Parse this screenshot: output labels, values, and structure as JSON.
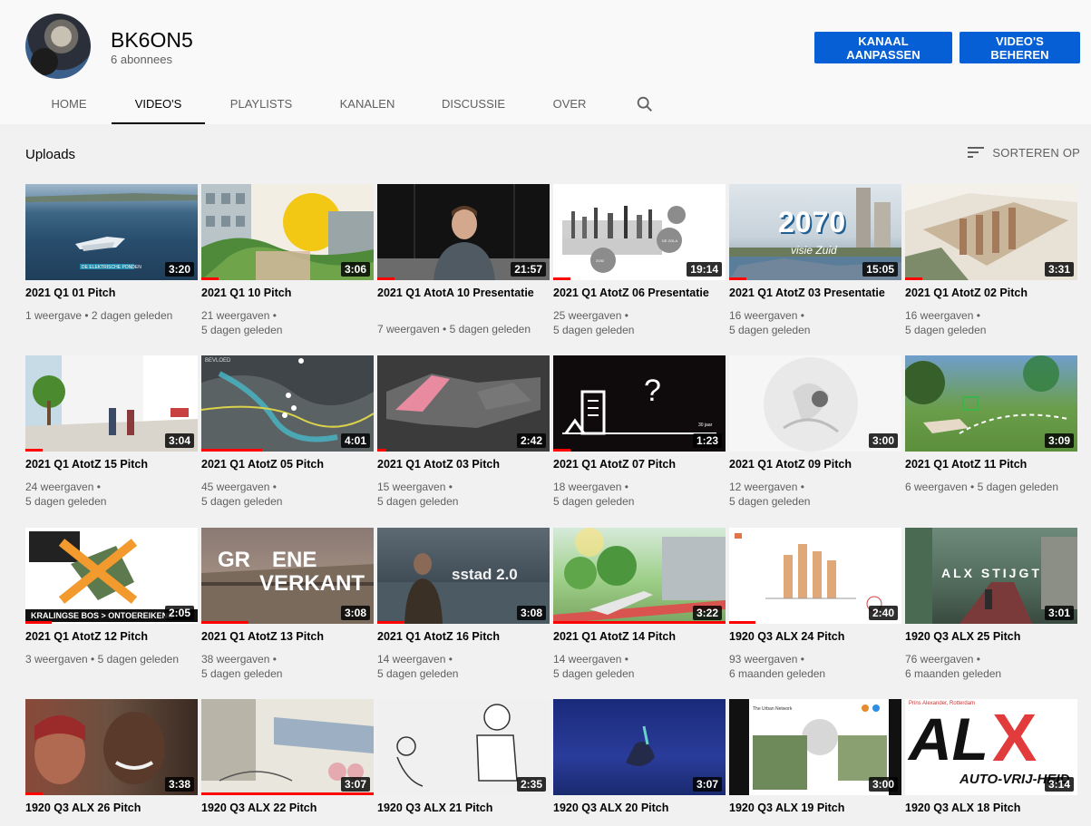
{
  "channel": {
    "name": "BK6ON5",
    "subscribers": "6 abonnees",
    "customize_label": "KANAAL AANPASSEN",
    "manage_label": "VIDEO'S BEHEREN"
  },
  "tabs": [
    {
      "label": "HOME"
    },
    {
      "label": "VIDEO'S"
    },
    {
      "label": "PLAYLISTS"
    },
    {
      "label": "KANALEN"
    },
    {
      "label": "DISCUSSIE"
    },
    {
      "label": "OVER"
    }
  ],
  "active_tab": "VIDEO'S",
  "section": {
    "title": "Uploads",
    "sort_label": "SORTEREN OP"
  },
  "videos": [
    {
      "title": "2021 Q1 01 Pitch",
      "meta1": "1 weergave • 2 dagen geleden",
      "meta2": "",
      "duration": "3:20",
      "progress": 0
    },
    {
      "title": "2021 Q1 10 Pitch",
      "meta1": "21 weergaven •",
      "meta2": "5 dagen geleden",
      "duration": "3:06",
      "progress": 0.1
    },
    {
      "title": "2021 Q1 AtotA 10 Presentatie",
      "meta1": "7 weergaven • 5 dagen geleden",
      "meta2": "",
      "duration": "21:57",
      "progress": 0.1
    },
    {
      "title": "2021 Q1 AtotZ 06 Presentatie",
      "meta1": "25 weergaven •",
      "meta2": "5 dagen geleden",
      "duration": "19:14",
      "progress": 0.1
    },
    {
      "title": "2021 Q1 AtotZ 03 Presentatie",
      "meta1": "16 weergaven •",
      "meta2": "5 dagen geleden",
      "duration": "15:05",
      "progress": 0.1
    },
    {
      "title": "2021 Q1 AtotZ 02 Pitch",
      "meta1": "16 weergaven •",
      "meta2": "5 dagen geleden",
      "duration": "3:31",
      "progress": 0.1
    },
    {
      "title": "2021 Q1 AtotZ 15 Pitch",
      "meta1": "24 weergaven •",
      "meta2": "5 dagen geleden",
      "duration": "3:04",
      "progress": 0.1
    },
    {
      "title": "2021 Q1 AtotZ 05 Pitch",
      "meta1": "45 weergaven •",
      "meta2": "5 dagen geleden",
      "duration": "4:01",
      "progress": 0.35
    },
    {
      "title": "2021 Q1 AtotZ 03 Pitch",
      "meta1": "15 weergaven •",
      "meta2": "5 dagen geleden",
      "duration": "2:42",
      "progress": 0.05
    },
    {
      "title": "2021 Q1 AtotZ 07 Pitch",
      "meta1": "18 weergaven •",
      "meta2": "5 dagen geleden",
      "duration": "1:23",
      "progress": 0.1
    },
    {
      "title": "2021 Q1 AtotZ 09 Pitch",
      "meta1": "12 weergaven •",
      "meta2": "5 dagen geleden",
      "duration": "3:00",
      "progress": 0
    },
    {
      "title": "2021 Q1 AtotZ 11 Pitch",
      "meta1": "6 weergaven • 5 dagen geleden",
      "meta2": "",
      "duration": "3:09",
      "progress": 0
    },
    {
      "title": "2021 Q1 AtotZ 12 Pitch",
      "meta1": "3 weergaven • 5 dagen geleden",
      "meta2": "",
      "duration": "2:05",
      "progress": 0.15
    },
    {
      "title": "2021 Q1 AtotZ 13 Pitch",
      "meta1": "38 weergaven •",
      "meta2": "5 dagen geleden",
      "duration": "3:08",
      "progress": 0.27
    },
    {
      "title": "2021 Q1 AtotZ 16 Pitch",
      "meta1": "14 weergaven •",
      "meta2": "5 dagen geleden",
      "duration": "3:08",
      "progress": 0.15
    },
    {
      "title": "2021 Q1 AtotZ 14 Pitch",
      "meta1": "14 weergaven •",
      "meta2": "5 dagen geleden",
      "duration": "3:22",
      "progress": 1
    },
    {
      "title": "1920 Q3 ALX 24 Pitch",
      "meta1": "93 weergaven •",
      "meta2": "6 maanden geleden",
      "duration": "2:40",
      "progress": 0.15
    },
    {
      "title": "1920 Q3 ALX 25 Pitch",
      "meta1": "76 weergaven •",
      "meta2": "6 maanden geleden",
      "duration": "3:01",
      "progress": 0
    },
    {
      "title": "1920 Q3 ALX 26 Pitch",
      "meta1": "",
      "meta2": "",
      "duration": "3:38",
      "progress": 0.1
    },
    {
      "title": "1920 Q3 ALX 22 Pitch",
      "meta1": "",
      "meta2": "",
      "duration": "3:07",
      "progress": 1
    },
    {
      "title": "1920 Q3 ALX 21 Pitch",
      "meta1": "",
      "meta2": "",
      "duration": "2:35",
      "progress": 0
    },
    {
      "title": "1920 Q3 ALX 20 Pitch",
      "meta1": "",
      "meta2": "",
      "duration": "3:07",
      "progress": 0
    },
    {
      "title": "1920 Q3 ALX 19 Pitch",
      "meta1": "",
      "meta2": "",
      "duration": "3:00",
      "progress": 0
    },
    {
      "title": "1920 Q3 ALX 18 Pitch",
      "meta1": "",
      "meta2": "",
      "duration": "3:14",
      "progress": 0
    }
  ],
  "thumb_text": {
    "t1_badge": "DE ELEKTRISCHE PONDEN",
    "t4_c1": "2030",
    "t4_c2": "DE ZOLA",
    "t5_big": "2070",
    "t5_sub": "visie Zuid",
    "t8_label": "BEVLOED",
    "t9_text": "sstad 2.0",
    "t10_q": "?",
    "t10_year": "30 jaar",
    "t13_strip": "KRALINGSE BOS > ONTOEREIKEND",
    "t14_a": "GR",
    "t14_b": "ENE",
    "t14_c": "VERKANT",
    "t18_text": "ALX STIJGT",
    "t23_title": "The Urban Network",
    "t24_big": "AL",
    "t24_x": "X",
    "t24_sub": "AUTO-VRIJ-HEID",
    "t24_top": "Prins Alexander, Rotterdam"
  }
}
